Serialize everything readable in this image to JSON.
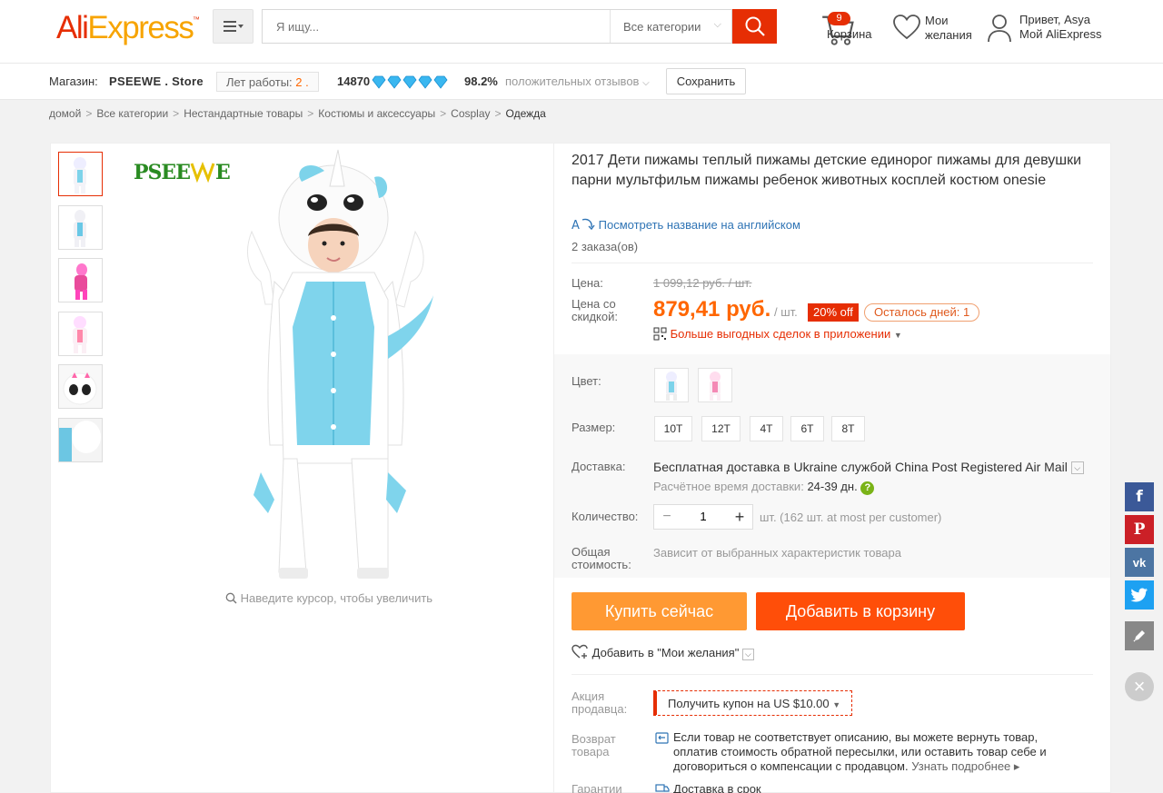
{
  "header": {
    "logo_ali": "Ali",
    "logo_express": "Express",
    "logo_tm": "™",
    "search_placeholder": "Я ищу...",
    "categories_label": "Все категории",
    "cart_count": "9",
    "cart_label": "Корзина",
    "wishlist_label_1": "Мои",
    "wishlist_label_2": "желания",
    "greeting": "Привет, Asya",
    "account_label": "Мой AliExpress"
  },
  "store": {
    "prefix": "Магазин:",
    "name": "PSEEWE . Store",
    "years_label": "Лет работы:",
    "years_value": "2 .",
    "rating_count": "14870",
    "positive_pct": "98.2%",
    "positive_label": "положительных отзывов",
    "save_label": "Сохранить"
  },
  "breadcrumb": [
    "домой",
    "Все категории",
    "Нестандартные товары",
    "Костюмы и аксессуары",
    "Cosplay",
    "Одежда"
  ],
  "gallery": {
    "brand_logo": "PSEEWE",
    "zoom_hint": "Наведите курсор, чтобы увеличить"
  },
  "product": {
    "title": "2017 Дети пижамы теплый пижамы детские единорог пижамы для девушки парни мультфильм пижамы ребенок животных косплей костюм onesie",
    "translate_link": "Посмотреть название на английском",
    "orders": "2 заказа(ов)",
    "price_label": "Цена:",
    "old_price": "1 099,12 руб. / шт.",
    "discount_price_label_1": "Цена со",
    "discount_price_label_2": "скидкой:",
    "new_price": "879,41 руб.",
    "unit": "/ шт.",
    "discount_badge": "20% off",
    "days_left": "Осталось дней: 1",
    "app_deals": "Больше выгодных сделок в приложении",
    "color_label": "Цвет:",
    "size_label": "Размер:",
    "sizes": [
      "10T",
      "12T",
      "4T",
      "6T",
      "8T"
    ],
    "delivery_label": "Доставка:",
    "delivery_text": "Бесплатная доставка в Ukraine службой China Post Registered Air Mail",
    "delivery_time_label": "Расчётное время доставки:",
    "delivery_time_value": "24-39 дн.",
    "quantity_label": "Количество:",
    "quantity_value": "1",
    "quantity_note": "шт. (162 шт. at most per customer)",
    "total_label_1": "Общая",
    "total_label_2": "стоимость:",
    "total_value": "Зависит от выбранных характеристик товара",
    "buy_now": "Купить сейчас",
    "add_to_cart": "Добавить в корзину",
    "add_wishlist": "Добавить в \"Мои желания\"",
    "promo_label_1": "Акция",
    "promo_label_2": "продавца:",
    "coupon_prefix": "Получить купон на",
    "coupon_value": "US $10.00",
    "return_label_1": "Возврат",
    "return_label_2": "товара",
    "return_text": "Если товар не соответствует описанию, вы можете вернуть товар, оплатив стоимость обратной пересылки, или оставить товар себе и договориться о компенсации с продавцом.",
    "return_more": "Узнать подробнее",
    "guarantee_label": "Гарантии",
    "guarantee_text": "Доставка в срок"
  },
  "social": [
    "f",
    "P",
    "vk"
  ],
  "colors": {
    "accent": "#e62e04",
    "orange": "#f60",
    "buy": "#ff9933",
    "cart": "#ff4e09"
  }
}
